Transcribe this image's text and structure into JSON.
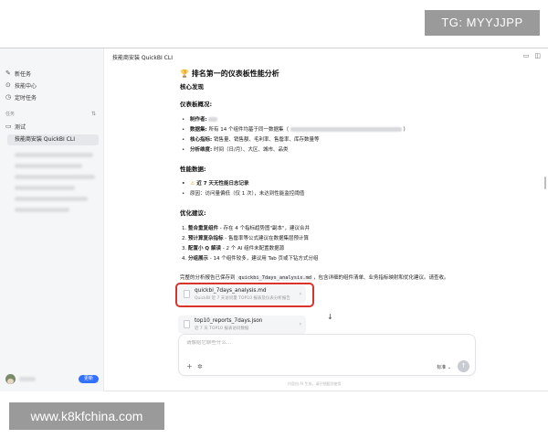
{
  "watermarks": {
    "top": "TG: MYYJJPP",
    "bottom": "www.k8kfchina.com"
  },
  "sidebar": {
    "items": [
      {
        "label": "新任务",
        "icon": "edit-icon"
      },
      {
        "label": "技能中心",
        "icon": "skill-icon"
      },
      {
        "label": "定时任务",
        "icon": "clock-icon"
      }
    ],
    "section_label": "任务",
    "folder_label": "测试",
    "active_task": "技能商安装 QuickBI CLI",
    "upgrade_label": "更新"
  },
  "topbar": {
    "title": "技能商安装 QuickBI CLI"
  },
  "content": {
    "heading": "排名第一的仪表板性能分析",
    "core_title": "核心发现",
    "overview_title": "仪表板概况:",
    "overview": [
      {
        "label": "制作者:",
        "value": ""
      },
      {
        "label": "数据集:",
        "value": "所有 14 个组件均基于同一数据集（"
      },
      {
        "label": "核心指标:",
        "value": "销售量、销售额、毛利率、售罄率、库存数量等"
      },
      {
        "label": "分析维度:",
        "value": "时间（日/月）、大区、城市、品类"
      }
    ],
    "perf_title": "性能数据:",
    "perf": [
      {
        "text": "近 7 天无性能日志记录",
        "bold": true
      },
      {
        "text": "原因：访问量偏低（仅 1 次），未达到性能监控阈值"
      }
    ],
    "opt_title": "优化建议:",
    "opt": [
      {
        "num": "1.",
        "bold": "整合重复组件",
        "rest": " - 存在 4 个指标趋势图\"副本\"，建议合并"
      },
      {
        "num": "2.",
        "bold": "预计算复杂指标",
        "rest": " - 售罄率等公式建议在数据集层预计算"
      },
      {
        "num": "3.",
        "bold": "配置小 Q 解读",
        "rest": " - 2 个 AI 组件未配置数据源"
      },
      {
        "num": "4.",
        "bold": "分组展示",
        "rest": " - 14 个组件较多，建议用 Tab 页或下钻方式分组"
      }
    ],
    "report_prefix": "完整的分析报告已保存到",
    "report_file": "quickbi_7days_analysis.md",
    "report_suffix": "，包含详细的组件清单、业务指标映射和优化建议。请查收。",
    "files": [
      {
        "name": "quickbi_7days_analysis.md",
        "desc": "QuickBI 近 7 天访问量 TOP10 报表及仪表分析报告"
      },
      {
        "name": "top10_reports_7days.json",
        "desc": "近 7 天 TOP10 报表访问数据"
      }
    ]
  },
  "composer": {
    "placeholder": "请像给它聊些什么...",
    "model_label": "标准"
  },
  "footnote": "内容由 AI 生成，请仔细甄别使用",
  "colors": {
    "accent": "#3370ff",
    "highlight": "#d9342b"
  }
}
